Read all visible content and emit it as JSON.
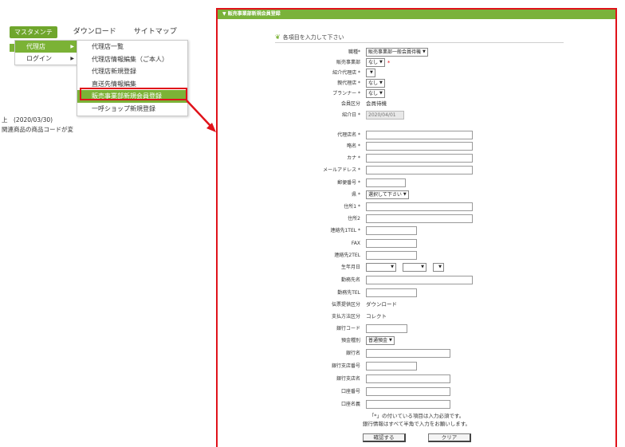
{
  "topnav": {
    "menu_button": "マスタメンテ",
    "download": "ダウンロード",
    "sitemap": "サイトマップ"
  },
  "submenu1": {
    "items": [
      {
        "label": "代理店"
      },
      {
        "label": "ログイン"
      }
    ]
  },
  "submenu2": {
    "items": [
      {
        "label": "代理店一覧"
      },
      {
        "label": "代理店情報編集（ご本人）"
      },
      {
        "label": "代理店新規登録"
      },
      {
        "label": "直送先情報編集"
      },
      {
        "label": "販売事業部新規会員登録"
      },
      {
        "label": "一呼ショップ新規登録"
      }
    ]
  },
  "left_text": {
    "date_line": "上　(2020/03/30)",
    "product_line": "関連商品の商品コードが変"
  },
  "panel": {
    "header": "▼ 販売事業部新規会員登録",
    "instruction": "各項目を入力して下さい"
  },
  "form": {
    "rank": {
      "label": "職種*",
      "value": "販売事業部一般会員待機"
    },
    "division": {
      "label": "販売事業部",
      "value": "なし"
    },
    "referral_agency": {
      "label": "紹介代理店 *",
      "value": ""
    },
    "parent_agency": {
      "label": "親代理店 *",
      "value": "なし"
    },
    "planner": {
      "label": "プランナー *",
      "value": "なし"
    },
    "member_category": {
      "label": "会員区分",
      "value": "会員待機"
    },
    "referral_date": {
      "label": "紹介日 *",
      "value": "2020/04/01"
    },
    "agency_name": {
      "label": "代理店名 *"
    },
    "short_name": {
      "label": "略名 *"
    },
    "kana": {
      "label": "カナ *"
    },
    "email": {
      "label": "メールアドレス *"
    },
    "postal": {
      "label": "郵便番号 *"
    },
    "prefecture": {
      "label": "県 *",
      "value": "選択して下さい"
    },
    "address1": {
      "label": "住所1 *"
    },
    "address2": {
      "label": "住所2"
    },
    "tel1": {
      "label": "連絡先1TEL *"
    },
    "fax": {
      "label": "FAX"
    },
    "tel2": {
      "label": "連絡先2TEL"
    },
    "birthday": {
      "label": "生年月日"
    },
    "workplace": {
      "label": "勤務先名"
    },
    "workplace_tel": {
      "label": "勤務先TEL"
    },
    "doc_delivery": {
      "label": "伝票提供区分",
      "value": "ダウンロード"
    },
    "payment": {
      "label": "支払方法区分",
      "value": "コレクト"
    },
    "bank_code": {
      "label": "銀行コード"
    },
    "deposit_type": {
      "label": "預金種別",
      "value": "普通預金"
    },
    "bank_name": {
      "label": "銀行名"
    },
    "branch_code": {
      "label": "銀行支店番号"
    },
    "branch_name": {
      "label": "銀行支店名"
    },
    "account_number": {
      "label": "口座番号"
    },
    "account_holder": {
      "label": "口座名義"
    }
  },
  "notes": {
    "line1": "「*」の付いている項目は入力必須です。",
    "line2": "銀行情報はすべて半角で入力をお願いします。"
  },
  "buttons": {
    "confirm": "確認する",
    "clear": "クリア"
  },
  "colors": {
    "accent_green": "#7bb236",
    "highlight_red": "#e0121a"
  }
}
